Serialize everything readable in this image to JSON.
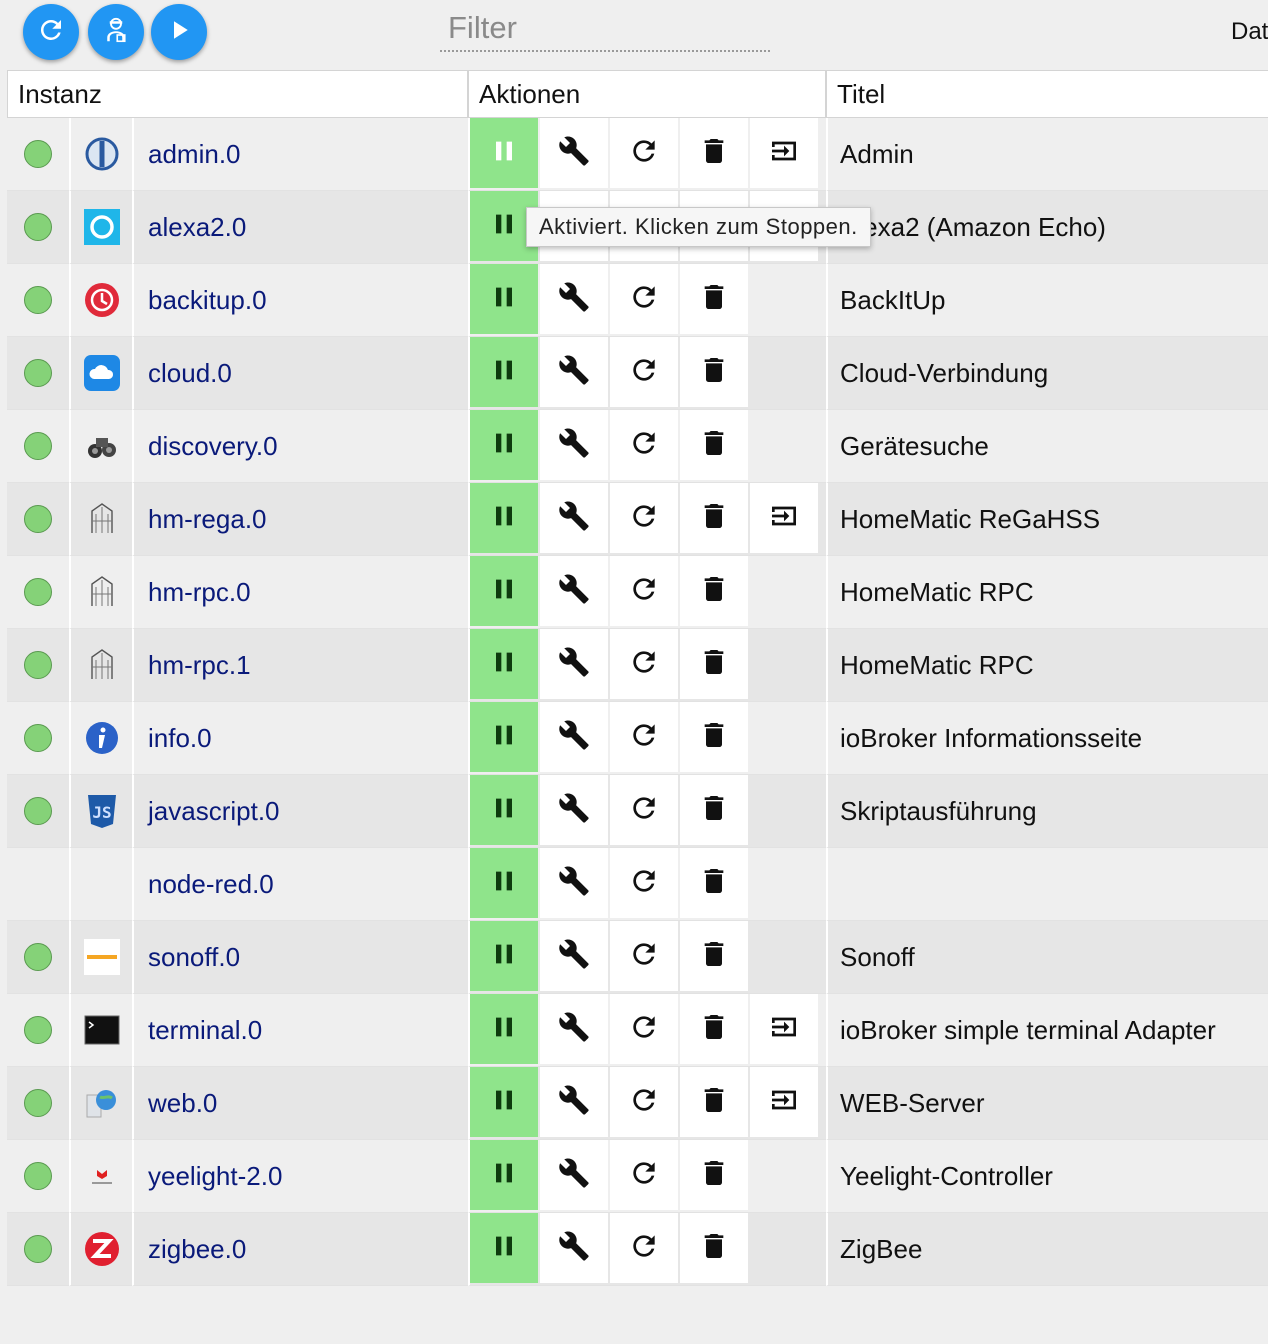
{
  "toolbar": {
    "buttons": [
      {
        "name": "refresh",
        "icon": "refresh-icon"
      },
      {
        "name": "expert-mode",
        "icon": "expert-user-icon"
      },
      {
        "name": "play",
        "icon": "play-icon"
      }
    ],
    "filter_placeholder": "Filter",
    "cut_label": "Dat"
  },
  "table": {
    "headers": {
      "instanz": "Instanz",
      "aktionen": "Aktionen",
      "titel": "Titel"
    },
    "rows": [
      {
        "name": "admin.0",
        "title": "Admin",
        "status": "green",
        "logo": "admin-logo-icon",
        "link": true
      },
      {
        "name": "alexa2.0",
        "title": "Alexa2 (Amazon Echo)",
        "status": "green",
        "logo": "alexa-logo-icon",
        "link": true
      },
      {
        "name": "backitup.0",
        "title": "BackItUp",
        "status": "green",
        "logo": "backitup-logo-icon",
        "link": false
      },
      {
        "name": "cloud.0",
        "title": "Cloud-Verbindung",
        "status": "green",
        "logo": "cloud-logo-icon",
        "link": false
      },
      {
        "name": "discovery.0",
        "title": "Gerätesuche",
        "status": "green",
        "logo": "binoculars-logo-icon",
        "link": false
      },
      {
        "name": "hm-rega.0",
        "title": "HomeMatic ReGaHSS",
        "status": "green",
        "logo": "homematic-logo-icon",
        "link": true
      },
      {
        "name": "hm-rpc.0",
        "title": "HomeMatic RPC",
        "status": "green",
        "logo": "homematic-logo-icon",
        "link": false
      },
      {
        "name": "hm-rpc.1",
        "title": "HomeMatic RPC",
        "status": "green",
        "logo": "homematic-logo-icon",
        "link": false
      },
      {
        "name": "info.0",
        "title": "ioBroker Informationsseite",
        "status": "green",
        "logo": "info-logo-icon",
        "link": false
      },
      {
        "name": "javascript.0",
        "title": "Skriptausführung",
        "status": "green",
        "logo": "javascript-logo-icon",
        "link": false
      },
      {
        "name": "node-red.0",
        "title": "",
        "status": "none",
        "logo": "",
        "link": false
      },
      {
        "name": "sonoff.0",
        "title": "Sonoff",
        "status": "green",
        "logo": "sonoff-logo-icon",
        "link": false
      },
      {
        "name": "terminal.0",
        "title": "ioBroker simple terminal Adapter",
        "status": "green",
        "logo": "terminal-logo-icon",
        "link": true
      },
      {
        "name": "web.0",
        "title": "WEB-Server",
        "status": "green",
        "logo": "web-logo-icon",
        "link": true
      },
      {
        "name": "yeelight-2.0",
        "title": "Yeelight-Controller",
        "status": "green",
        "logo": "yeelight-logo-icon",
        "link": false
      },
      {
        "name": "zigbee.0",
        "title": "ZigBee",
        "status": "green",
        "logo": "zigbee-logo-icon",
        "link": false
      }
    ]
  },
  "tooltip": {
    "text": "Aktiviert. Klicken zum Stoppen."
  },
  "colors": {
    "accent": "#2196f3",
    "active": "#8fe48b",
    "status_green": "#85d278",
    "link": "#0a1a7a"
  }
}
